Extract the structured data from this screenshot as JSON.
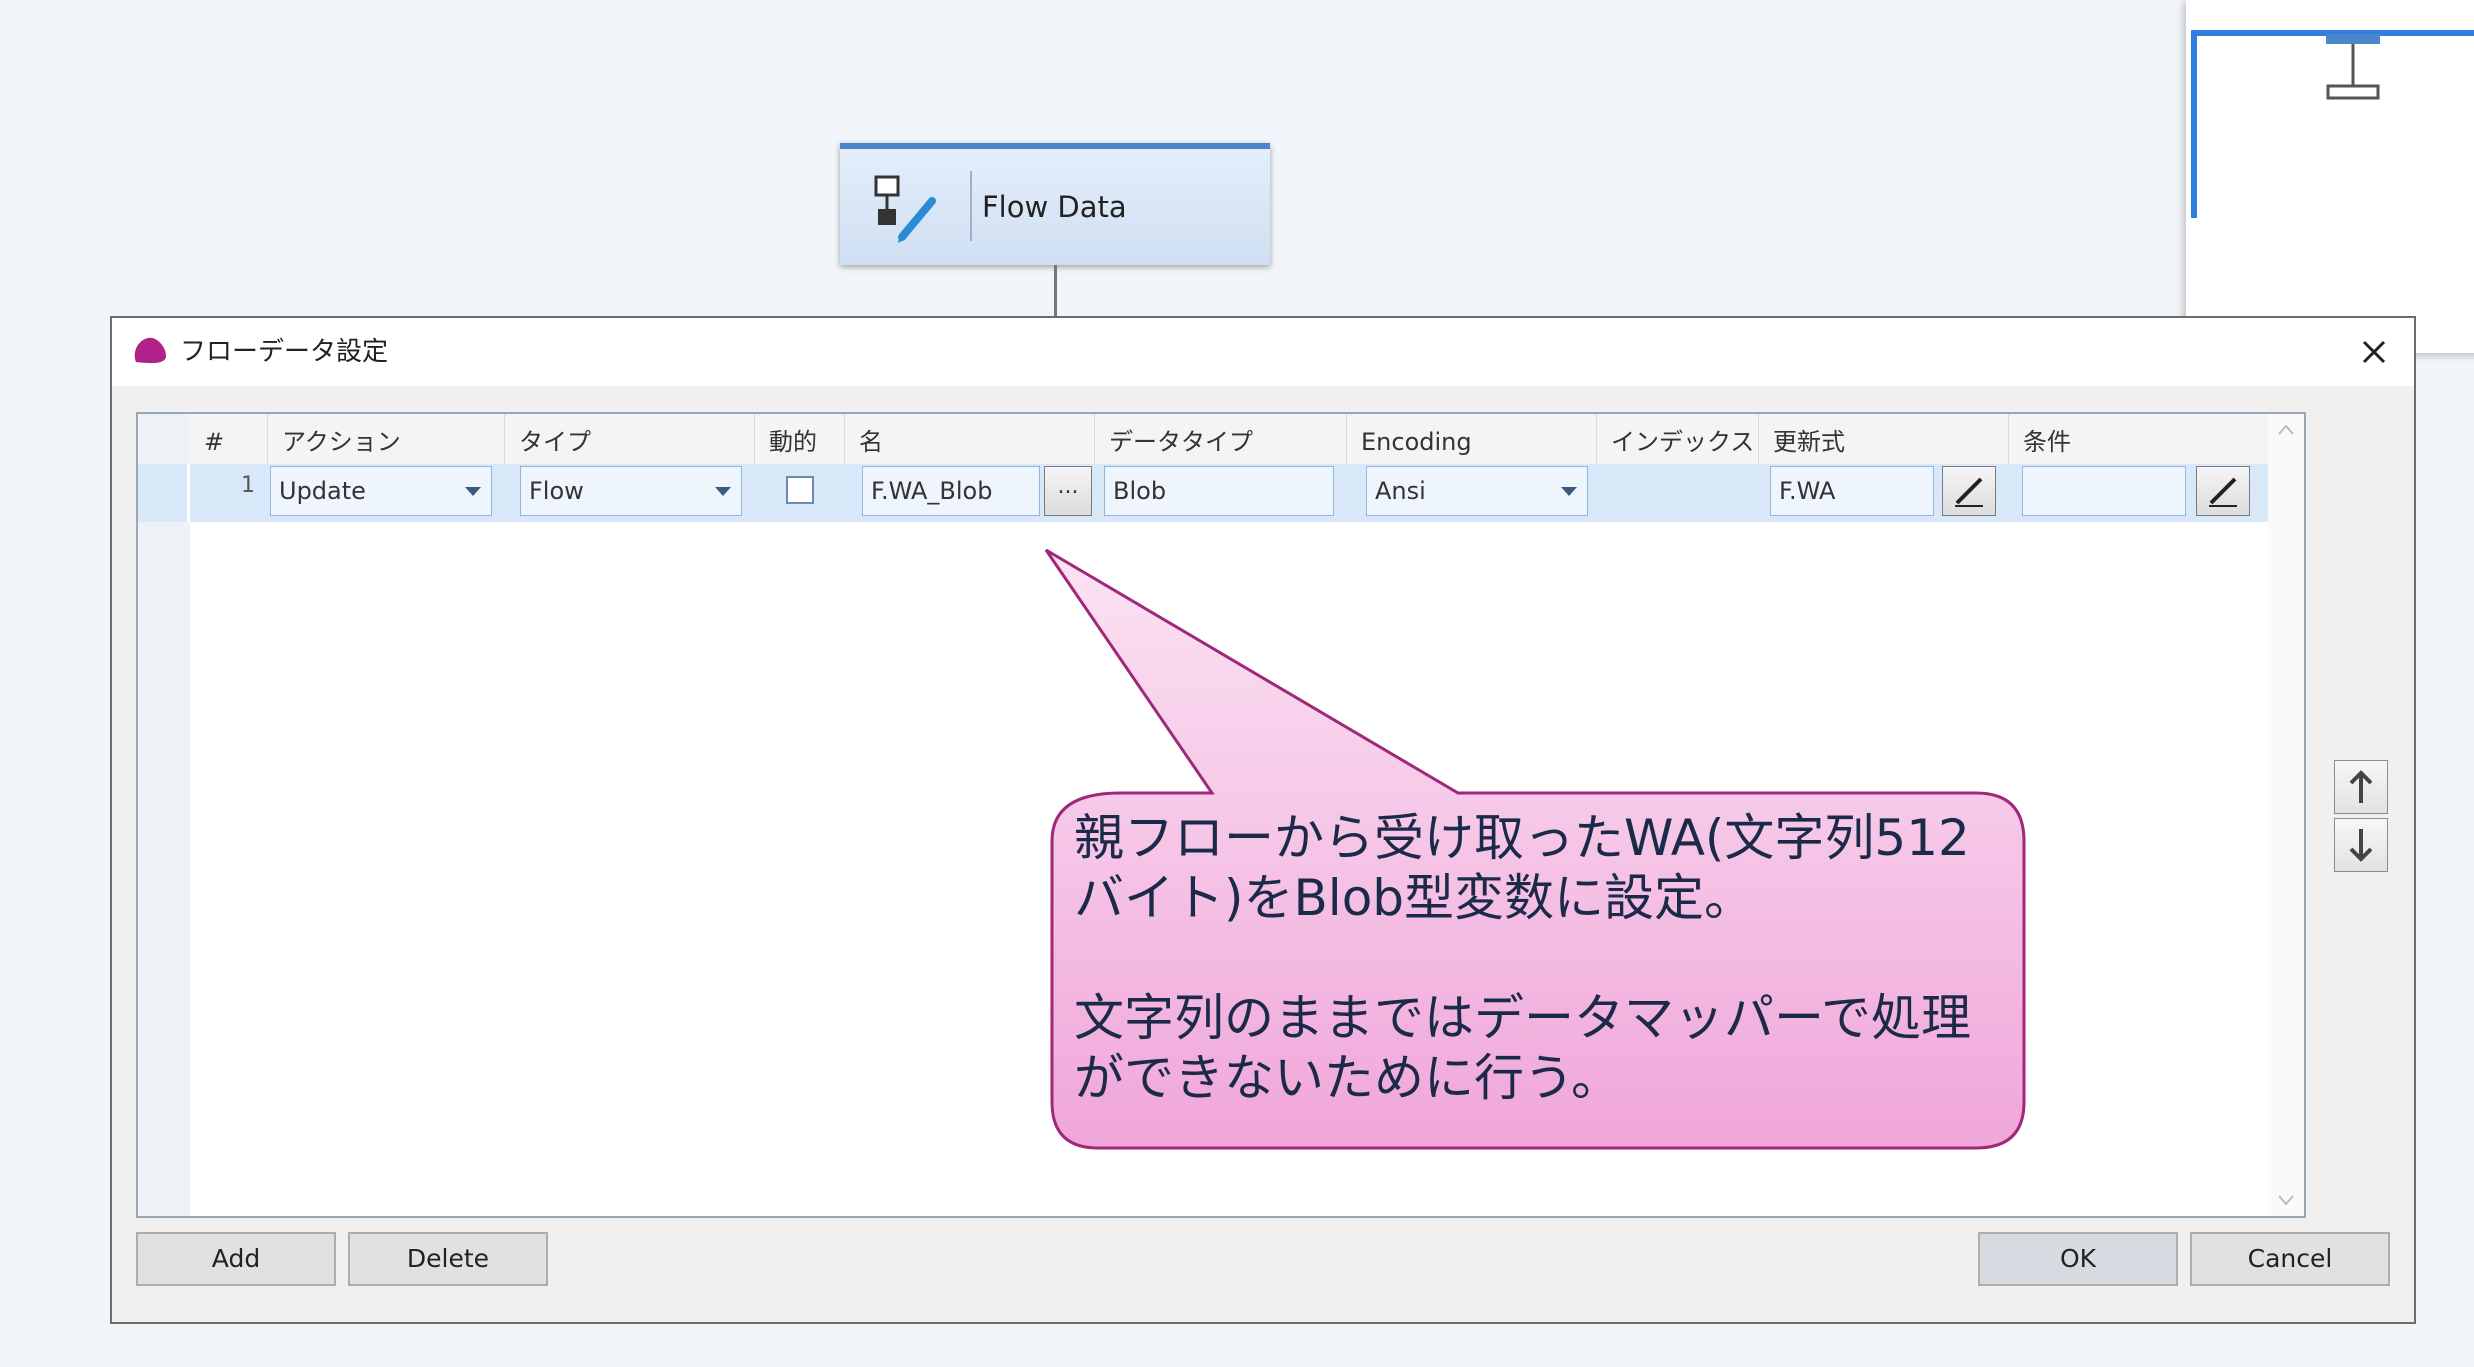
{
  "canvas": {
    "node_label": "Flow Data"
  },
  "dialog": {
    "title": "フローデータ設定",
    "columns": [
      "#",
      "アクション",
      "タイプ",
      "動的",
      "名",
      "データタイプ",
      "Encoding",
      "インデックス",
      "更新式",
      "条件"
    ],
    "row": {
      "number": "1",
      "action": "Update",
      "type": "Flow",
      "dynamic_checked": false,
      "name": "F.WA_Blob",
      "name_button": "...",
      "data_type": "Blob",
      "encoding": "Ansi",
      "index": "",
      "update_expr": "F.WA",
      "condition": ""
    },
    "buttons": {
      "add": "Add",
      "delete": "Delete",
      "ok": "OK",
      "cancel": "Cancel"
    }
  },
  "callout": {
    "text": "親フローから受け取ったWA(文字列512\nバイト)をBlob型変数に設定。\n\n文字列のままではデータマッパーで処理\nができないために行う。",
    "fill_top": "#fbe3f3",
    "fill_bottom": "#f0a6d9",
    "stroke": "#a0287a"
  },
  "colors": {
    "accent": "#2f7fe0",
    "row_highlight": "#d9e8f8"
  }
}
